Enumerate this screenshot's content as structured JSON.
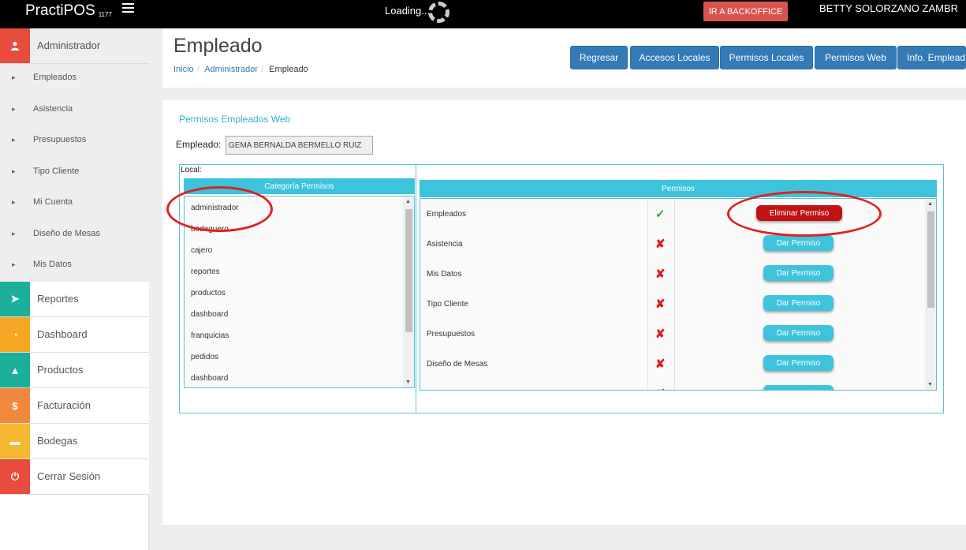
{
  "topbar": {
    "brand": "PractiPOS",
    "brand_number": "1177",
    "loading_text": "Loading...",
    "backoffice_button": "IR A BACKOFFICE",
    "user_name": "BETTY SOLORZANO ZAMBR"
  },
  "sidebar": {
    "admin_label": "Administrador",
    "submenu": [
      "Empleados",
      "Asistencia",
      "Presupuestos",
      "Tipo Cliente",
      "Mi Cuenta",
      "Diseño de Mesas",
      "Mis Datos"
    ],
    "items": [
      {
        "label": "Reportes",
        "icon": "rocket-icon",
        "color": "#1caf9a"
      },
      {
        "label": "Dashboard",
        "icon": "dashboard-icon",
        "color": "#f5a623"
      },
      {
        "label": "Productos",
        "icon": "product-icon",
        "color": "#1caf9a"
      },
      {
        "label": "Facturación",
        "icon": "dollar-icon",
        "color": "#f0883d"
      },
      {
        "label": "Bodegas",
        "icon": "warehouse-icon",
        "color": "#f5b82e"
      },
      {
        "label": "Cerrar Sesión",
        "icon": "power-icon",
        "color": "#e74c3c"
      }
    ],
    "admin_color": "#e74c3c"
  },
  "header": {
    "title": "Empleado",
    "breadcrumb": [
      "Inicio",
      "Administrador",
      "Empleado"
    ],
    "buttons": [
      "Regresar",
      "Accesos Locales",
      "Permisos Locales",
      "Permisos Web",
      "Info. Empleado"
    ]
  },
  "panel": {
    "title": "Permisos Empleados Web",
    "employee_label": "Empleado:",
    "employee_value": "GEMA BERNALDA BERMELLO RUIZ",
    "local_label": "Local:",
    "category_header": "Categoría Permisos",
    "categories": [
      "administrador",
      "bodeguero",
      "cajero",
      "reportes",
      "productos",
      "dashboard",
      "franquicias",
      "pedidos",
      "dashboard"
    ],
    "permissions_header": "Permisos",
    "permissions": [
      {
        "name": "Empleados",
        "granted": true,
        "action": "Eliminar Permiso"
      },
      {
        "name": "Asistencia",
        "granted": false,
        "action": "Dar Permiso"
      },
      {
        "name": "Mis Datos",
        "granted": false,
        "action": "Dar Permiso"
      },
      {
        "name": "Tipo Cliente",
        "granted": false,
        "action": "Dar Permiso"
      },
      {
        "name": "Presupuestos",
        "granted": false,
        "action": "Dar Permiso"
      },
      {
        "name": "Diseño de Mesas",
        "granted": false,
        "action": "Dar Permiso"
      },
      {
        "name": "",
        "granted": false,
        "action": "Dar Permiso"
      }
    ],
    "check_mark": "✓",
    "cross_mark": "✘"
  }
}
